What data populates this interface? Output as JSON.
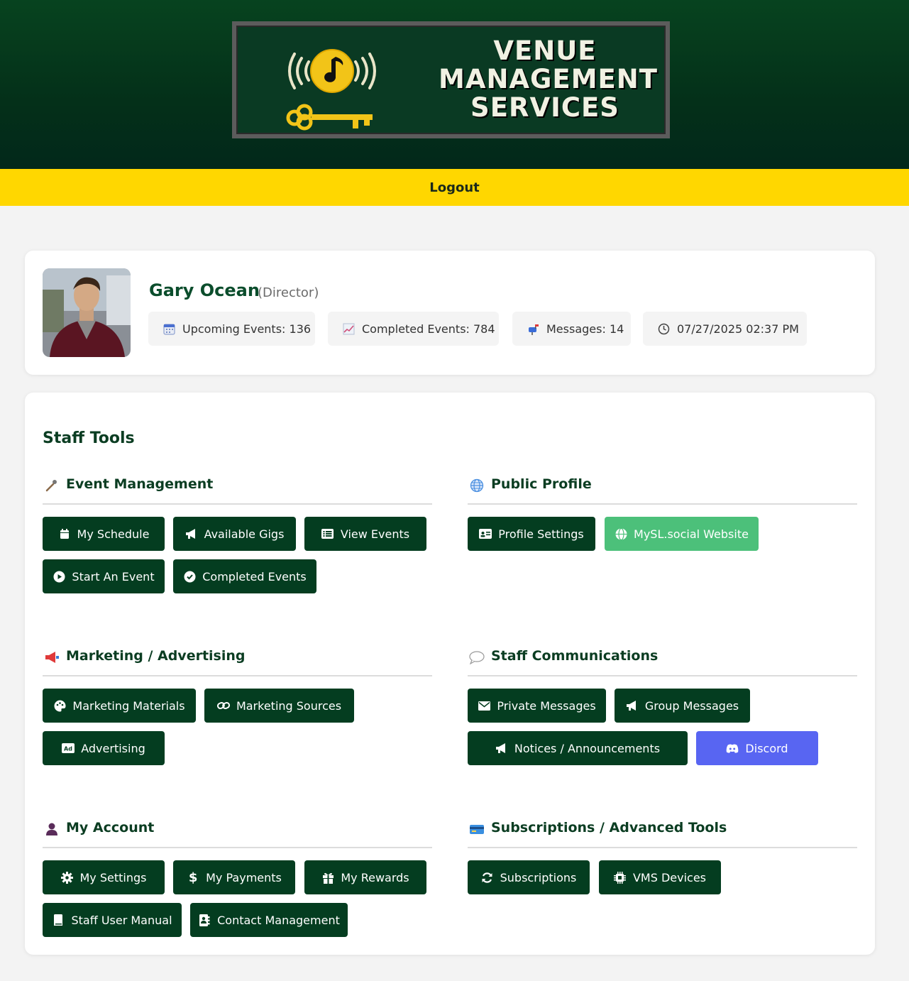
{
  "header": {
    "logo_lines": [
      "VENUE",
      "MANAGEMENT",
      "SERVICES"
    ],
    "logout_label": "Logout"
  },
  "profile": {
    "name": "Gary Ocean",
    "role": "(Director)",
    "stats": [
      {
        "label": "Upcoming Events: 136",
        "icon": "calendar-icon"
      },
      {
        "label": "Completed Events: 784",
        "icon": "chart-icon"
      },
      {
        "label": "Messages: 14",
        "icon": "mailbox-icon"
      },
      {
        "label": "07/27/2025 02:37 PM",
        "icon": "clock-icon"
      }
    ]
  },
  "tools": {
    "title": "Staff Tools",
    "sections": {
      "event_management": {
        "title": "Event Management",
        "buttons": [
          "My Schedule",
          "Available Gigs",
          "View Events",
          "Start An Event",
          "Completed Events"
        ]
      },
      "public_profile": {
        "title": "Public Profile",
        "buttons": [
          "Profile Settings",
          "MySL.social Website"
        ]
      },
      "marketing": {
        "title": "Marketing / Advertising",
        "buttons": [
          "Marketing Materials",
          "Marketing Sources",
          "Advertising"
        ]
      },
      "communications": {
        "title": "Staff Communications",
        "buttons": [
          "Private Messages",
          "Group Messages",
          "Notices / Announcements",
          "Discord"
        ]
      },
      "account": {
        "title": "My Account",
        "buttons": [
          "My Settings",
          "My Payments",
          "My Rewards",
          "Staff User Manual",
          "Contact Management"
        ]
      },
      "subscriptions": {
        "title": "Subscriptions / Advanced Tools",
        "buttons": [
          "Subscriptions",
          "VMS Devices"
        ]
      }
    }
  },
  "colors": {
    "header_green": "#043019",
    "logout_yellow": "#ffd700",
    "button_green": "#043d20",
    "accent_green": "#4cc07a",
    "discord": "#5865f2"
  }
}
